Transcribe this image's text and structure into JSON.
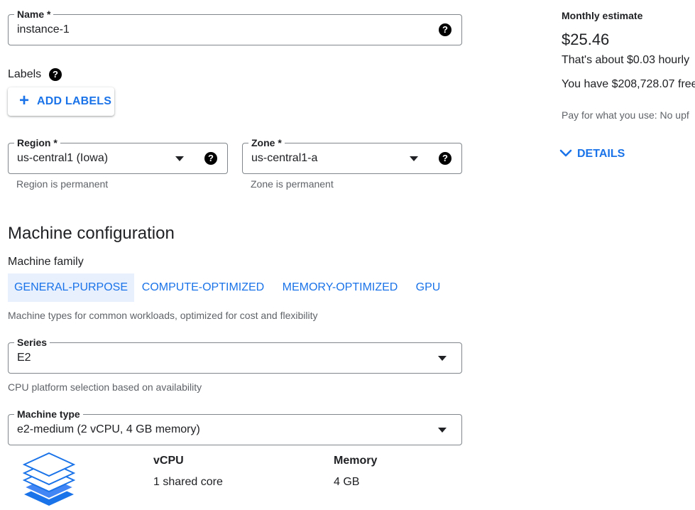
{
  "name_field": {
    "label": "Name *",
    "value": "instance-1"
  },
  "labels": {
    "title": "Labels",
    "add_button": "ADD LABELS"
  },
  "region_field": {
    "label": "Region *",
    "value": "us-central1 (Iowa)",
    "hint": "Region is permanent"
  },
  "zone_field": {
    "label": "Zone *",
    "value": "us-central1-a",
    "hint": "Zone is permanent"
  },
  "machine_config": {
    "title": "Machine configuration",
    "family_label": "Machine family",
    "tabs": [
      "GENERAL-PURPOSE",
      "COMPUTE-OPTIMIZED",
      "MEMORY-OPTIMIZED",
      "GPU"
    ],
    "active_tab": "GENERAL-PURPOSE",
    "family_description": "Machine types for common workloads, optimized for cost and flexibility"
  },
  "series_field": {
    "label": "Series",
    "value": "E2",
    "hint": "CPU platform selection based on availability"
  },
  "machine_type_field": {
    "label": "Machine type",
    "value": "e2-medium (2 vCPU, 4 GB memory)"
  },
  "specs": {
    "vcpu_label": "vCPU",
    "vcpu_value": "1 shared core",
    "memory_label": "Memory",
    "memory_value": "4 GB"
  },
  "estimate": {
    "title": "Monthly estimate",
    "price": "$25.46",
    "hourly": "That's about $0.03 hourly",
    "credit": "You have $208,728.07 free",
    "pay_note": "Pay for what you use: No upf",
    "details_button": "DETAILS"
  },
  "icons": {
    "help": "help-circle-icon",
    "dropdown": "caret-down-icon",
    "add": "plus-icon",
    "expand": "chevron-down-icon",
    "machine": "layers-icon"
  },
  "colors": {
    "accent": "#1a73e8",
    "active_tab_bg": "#e8f0fe",
    "border": "#80868b"
  }
}
